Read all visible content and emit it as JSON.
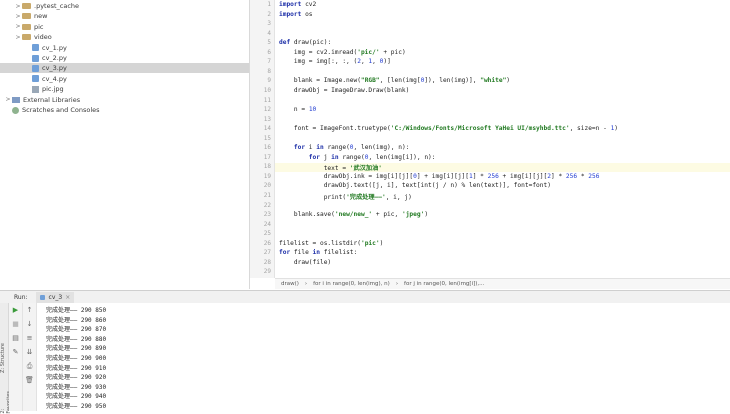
{
  "project_tree": [
    {
      "label": ".pytest_cache",
      "type": "folder",
      "indent": 1,
      "expand": ">"
    },
    {
      "label": "new",
      "type": "folder",
      "indent": 1,
      "expand": ">"
    },
    {
      "label": "pic",
      "type": "folder",
      "indent": 1,
      "expand": ">"
    },
    {
      "label": "video",
      "type": "folder",
      "indent": 1,
      "expand": ">"
    },
    {
      "label": "cv_1.py",
      "type": "py",
      "indent": 2,
      "expand": ""
    },
    {
      "label": "cv_2.py",
      "type": "py",
      "indent": 2,
      "expand": ""
    },
    {
      "label": "cv_3.py",
      "type": "py",
      "indent": 2,
      "expand": "",
      "selected": true
    },
    {
      "label": "cv_4.py",
      "type": "py",
      "indent": 2,
      "expand": ""
    },
    {
      "label": "pic.jpg",
      "type": "img",
      "indent": 2,
      "expand": ""
    },
    {
      "label": "External Libraries",
      "type": "lib",
      "indent": 0,
      "expand": ">"
    },
    {
      "label": "Scratches and Consoles",
      "type": "scratch",
      "indent": 0,
      "expand": ""
    }
  ],
  "line_numbers": [
    "1",
    "2",
    "3",
    "4",
    "5",
    "6",
    "7",
    "8",
    "9",
    "10",
    "11",
    "12",
    "13",
    "14",
    "15",
    "16",
    "17",
    "18",
    "19",
    "20",
    "21",
    "22",
    "23",
    "24",
    "25",
    "26",
    "27",
    "28",
    "29"
  ],
  "current_line_index": 17,
  "code_lines": [
    [
      [
        "kw",
        "import"
      ],
      [
        "t",
        " cv2"
      ]
    ],
    [
      [
        "kw",
        "import"
      ],
      [
        "t",
        " os"
      ]
    ],
    [],
    [],
    [
      [
        "kw",
        "def"
      ],
      [
        "t",
        " draw(pic):"
      ]
    ],
    [
      [
        "t",
        "    img = cv2.imread("
      ],
      [
        "str",
        "'pic/'"
      ],
      [
        "t",
        " + pic)"
      ]
    ],
    [
      [
        "t",
        "    img = img[:, :, ("
      ],
      [
        "num",
        "2"
      ],
      [
        "t",
        ", "
      ],
      [
        "num",
        "1"
      ],
      [
        "t",
        ", "
      ],
      [
        "num",
        "0"
      ],
      [
        "t",
        ")]"
      ]
    ],
    [],
    [
      [
        "t",
        "    blank = Image.new("
      ],
      [
        "str",
        "\"RGB\""
      ],
      [
        "t",
        ", [len(img["
      ],
      [
        "num",
        "0"
      ],
      [
        "t",
        "]), len(img)], "
      ],
      [
        "str",
        "\"white\""
      ],
      [
        "t",
        ")"
      ]
    ],
    [
      [
        "t",
        "    drawObj = ImageDraw.Draw(blank)"
      ]
    ],
    [],
    [
      [
        "t",
        "    n = "
      ],
      [
        "num",
        "10"
      ]
    ],
    [],
    [
      [
        "t",
        "    font = ImageFont.truetype("
      ],
      [
        "str",
        "'C:/Windows/Fonts/Microsoft YaHei UI/msyhbd.ttc'"
      ],
      [
        "t",
        ", size=n - "
      ],
      [
        "num",
        "1"
      ],
      [
        "t",
        ")"
      ]
    ],
    [],
    [
      [
        "kw",
        "    for"
      ],
      [
        "t",
        " i "
      ],
      [
        "kw",
        "in"
      ],
      [
        "t",
        " range("
      ],
      [
        "num",
        "0"
      ],
      [
        "t",
        ", len(img), n):"
      ]
    ],
    [
      [
        "kw",
        "        for"
      ],
      [
        "t",
        " j "
      ],
      [
        "kw",
        "in"
      ],
      [
        "t",
        " range("
      ],
      [
        "num",
        "0"
      ],
      [
        "t",
        ", len(img[i]), n):"
      ]
    ],
    [
      [
        "t",
        "            text = "
      ],
      [
        "str",
        "'武汉加油'"
      ]
    ],
    [
      [
        "t",
        "            drawObj.ink = img[i][j]["
      ],
      [
        "num",
        "0"
      ],
      [
        "t",
        "] + img[i][j]["
      ],
      [
        "num",
        "1"
      ],
      [
        "t",
        "] * "
      ],
      [
        "num",
        "256"
      ],
      [
        "t",
        " + img[i][j]["
      ],
      [
        "num",
        "2"
      ],
      [
        "t",
        "] * "
      ],
      [
        "num",
        "256"
      ],
      [
        "t",
        " * "
      ],
      [
        "num",
        "256"
      ]
    ],
    [
      [
        "t",
        "            drawObj.text([j, i], text[int(j / n) % len(text)], font=font)"
      ]
    ],
    [
      [
        "t",
        "            print("
      ],
      [
        "str",
        "'完成处理——'"
      ],
      [
        "t",
        ", i, j)"
      ]
    ],
    [],
    [
      [
        "t",
        "    blank.save("
      ],
      [
        "str",
        "'new/new_'"
      ],
      [
        "t",
        " + pic, "
      ],
      [
        "str",
        "'jpeg'"
      ],
      [
        "t",
        ")"
      ]
    ],
    [],
    [],
    [
      [
        "t",
        "filelist = os.listdir("
      ],
      [
        "str",
        "'pic'"
      ],
      [
        "t",
        ")"
      ]
    ],
    [
      [
        "kw",
        "for"
      ],
      [
        "t",
        " file "
      ],
      [
        "kw",
        "in"
      ],
      [
        "t",
        " filelist:"
      ]
    ],
    [
      [
        "t",
        "    draw(file)"
      ]
    ],
    []
  ],
  "breadcrumb": [
    "draw()",
    "for i in range(0, len(img), n)",
    "for j in range(0, len(img[i]),..."
  ],
  "run": {
    "label": "Run:",
    "config": "cv_3",
    "side_tabs": [
      "Z: Structure",
      "2: Favorites"
    ]
  },
  "console_lines": [
    "完成处理—— 290 850",
    "完成处理—— 290 860",
    "完成处理—— 290 870",
    "完成处理—— 290 880",
    "完成处理—— 290 890",
    "完成处理—— 290 900",
    "完成处理—— 290 910",
    "完成处理—— 290 920",
    "完成处理—— 290 930",
    "完成处理—— 290 940",
    "完成处理—— 290 950"
  ],
  "colors": {
    "keyword": "#1d2fa8",
    "string": "#227a22",
    "number": "#1f3ad0",
    "selection": "#d5d5d5",
    "current_line": "#fdfbe3"
  }
}
